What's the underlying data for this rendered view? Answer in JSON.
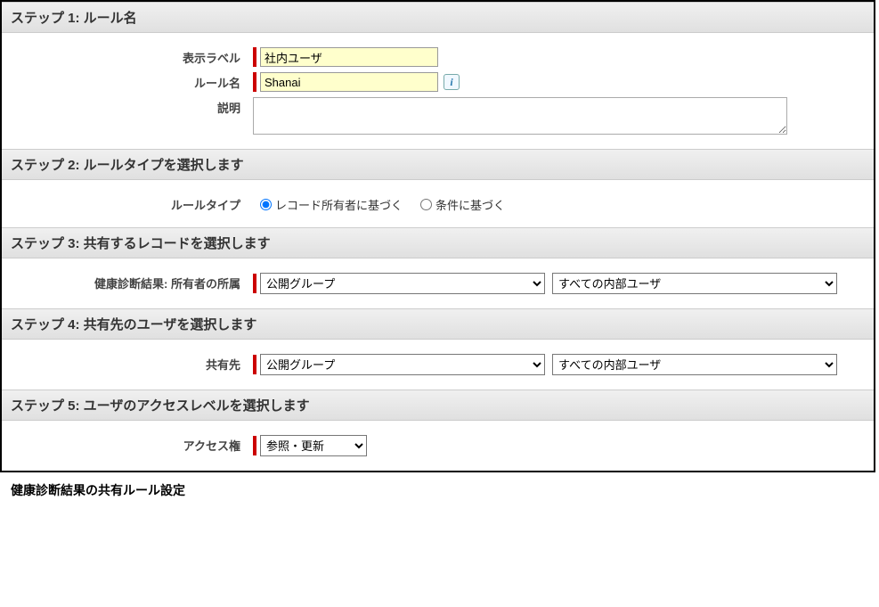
{
  "step1": {
    "title": "ステップ 1: ルール名",
    "labels": {
      "displayLabel": "表示ラベル",
      "ruleName": "ルール名",
      "description": "説明"
    },
    "values": {
      "displayLabel": "社内ユーザ",
      "ruleName": "Shanai",
      "description": ""
    }
  },
  "step2": {
    "title": "ステップ 2: ルールタイプを選択します",
    "labels": {
      "ruleType": "ルールタイプ"
    },
    "options": {
      "ownerBased": "レコード所有者に基づく",
      "criteriaBased": "条件に基づく"
    },
    "selected": "ownerBased"
  },
  "step3": {
    "title": "ステップ 3: 共有するレコードを選択します",
    "labels": {
      "ownerMembership": "健康診断結果: 所有者の所属"
    },
    "select1": {
      "value": "公開グループ"
    },
    "select2": {
      "value": "すべての内部ユーザ"
    }
  },
  "step4": {
    "title": "ステップ 4: 共有先のユーザを選択します",
    "labels": {
      "shareWith": "共有先"
    },
    "select1": {
      "value": "公開グループ"
    },
    "select2": {
      "value": "すべての内部ユーザ"
    }
  },
  "step5": {
    "title": "ステップ 5: ユーザのアクセスレベルを選択します",
    "labels": {
      "access": "アクセス権"
    },
    "select": {
      "value": "参照・更新"
    }
  },
  "caption": "健康診断結果の共有ルール設定"
}
